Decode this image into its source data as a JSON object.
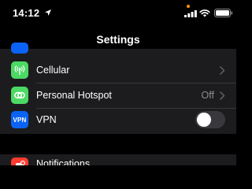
{
  "status_bar": {
    "time": "14:12"
  },
  "nav": {
    "title": "Settings"
  },
  "rows": [
    {
      "label": "Cellular",
      "value": "",
      "icon": "antenna-icon",
      "icon_color": "#4cd964"
    },
    {
      "label": "Personal Hotspot",
      "value": "Off",
      "icon": "link-icon",
      "icon_color": "#4cd964"
    },
    {
      "label": "VPN",
      "value": "",
      "icon_text": "VPN",
      "icon_color": "#0a63f6",
      "toggle_on": false
    }
  ],
  "notifications": {
    "label": "Notifications",
    "icon_color": "#ff3b30"
  },
  "colors": {
    "background": "#000000",
    "group": "#1c1c1e",
    "secondary_text": "#8e8e93",
    "orange_dot": "#ff9500",
    "top_cut_icon": "#0a63f6"
  }
}
